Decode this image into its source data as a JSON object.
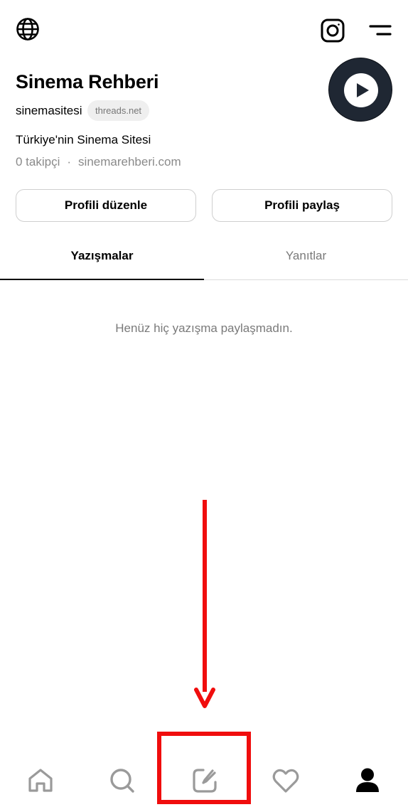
{
  "profile": {
    "name": "Sinema Rehberi",
    "handle": "sinemasitesi",
    "badge": "threads.net",
    "bio": "Türkiye'nin Sinema Sitesi",
    "followers": "0 takipçi",
    "separator": "·",
    "website": "sinemarehberi.com"
  },
  "buttons": {
    "edit_label": "Profili düzenle",
    "share_label": "Profili paylaş"
  },
  "tabs": [
    {
      "label": "Yazışmalar",
      "active": true
    },
    {
      "label": "Yanıtlar",
      "active": false
    }
  ],
  "empty_state": "Henüz hiç yazışma paylaşmadın.",
  "top_icons": [
    "globe-icon",
    "instagram-icon",
    "menu-icon"
  ],
  "nav_icons": [
    "home-icon",
    "search-icon",
    "compose-icon",
    "heart-icon",
    "profile-icon"
  ],
  "colors": {
    "annotation": "#f00d0d",
    "avatar_bg": "#1f2733",
    "muted_text": "#8a8a8a"
  }
}
